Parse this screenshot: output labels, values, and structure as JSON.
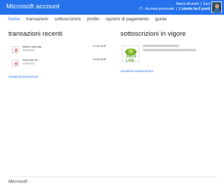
{
  "header": {
    "brand": "Microsoft account",
    "user_name": "Marco Brunelli",
    "sign_out": "Esci",
    "locale": "IT - Account personale",
    "points": "L'utente ha 0 punti",
    "accent_color": "#2672ec"
  },
  "nav": {
    "items": [
      "home",
      "transazioni",
      "sottoscrizioni",
      "profilo",
      "opzioni di pagamento",
      "guida"
    ],
    "active": "home"
  },
  "transactions": {
    "title": "transazioni recenti",
    "rows": [
      {
        "name": "Week Calendar",
        "date": "29/05/2012",
        "price": "€ 0,99 EUR",
        "icon": "app-tile-icon"
      },
      {
        "name": "Feed Me Oil",
        "date": "27/05/2012",
        "price": "€ 0,99 EUR",
        "icon": "app-tile-icon"
      }
    ],
    "link": "visualizza transazioni"
  },
  "subscriptions": {
    "title": "sottoscrizioni in vigore",
    "tile_label": "XBOX LIVE",
    "link": "visualizza sottoscrizioni"
  },
  "footer": {
    "logo": "Microsoft"
  }
}
